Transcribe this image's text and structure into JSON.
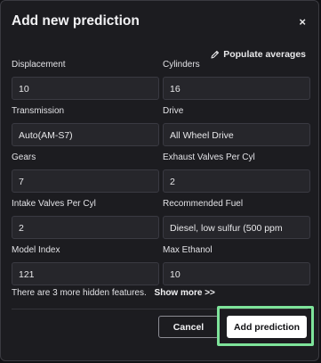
{
  "dialog": {
    "title": "Add new prediction",
    "close_glyph": "×",
    "populate_label": "Populate averages",
    "populate_icon": "pencil-icon"
  },
  "fields": {
    "displacement": {
      "label": "Displacement",
      "value": "10"
    },
    "cylinders": {
      "label": "Cylinders",
      "value": "16"
    },
    "transmission": {
      "label": "Transmission",
      "value": "Auto(AM-S7)"
    },
    "drive": {
      "label": "Drive",
      "value": "All Wheel Drive"
    },
    "gears": {
      "label": "Gears",
      "value": "7"
    },
    "exhaust_valves": {
      "label": "Exhaust Valves Per Cyl",
      "value": "2"
    },
    "intake_valves": {
      "label": "Intake Valves Per Cyl",
      "value": "2"
    },
    "recommended_fuel": {
      "label": "Recommended Fuel",
      "value": "Diesel, low sulfur (500 ppm"
    },
    "model_index": {
      "label": "Model Index",
      "value": "121"
    },
    "max_ethanol": {
      "label": "Max Ethanol",
      "value": "10"
    }
  },
  "hidden_features": {
    "text": "There are 3 more hidden features.",
    "link": "Show more >>"
  },
  "footer": {
    "cancel_label": "Cancel",
    "submit_label": "Add prediction",
    "highlight_color": "#7ee39a"
  }
}
